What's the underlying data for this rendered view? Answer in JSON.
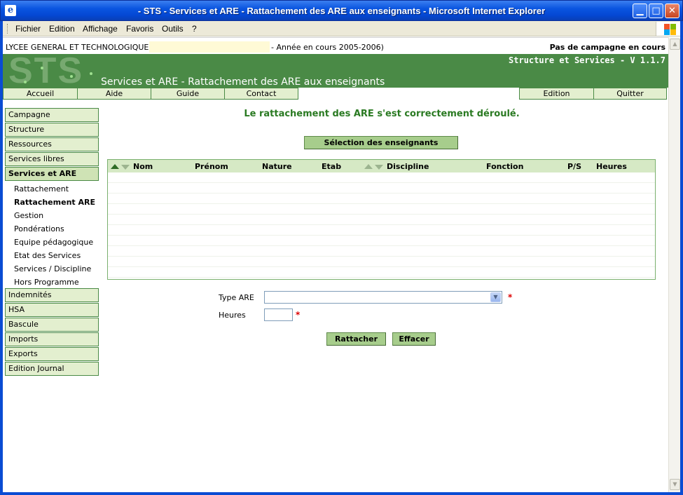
{
  "window": {
    "title": "- STS - Services et ARE - Rattachement des ARE aux enseignants - Microsoft Internet Explorer",
    "app_icon": "e",
    "min_glyph": "▁",
    "max_glyph": "□",
    "close_glyph": "✕"
  },
  "menubar": {
    "items": [
      "Fichier",
      "Edition",
      "Affichage",
      "Favoris",
      "Outils",
      "?"
    ]
  },
  "header": {
    "lycee": "LYCEE GENERAL ET TECHNOLOGIQUE",
    "annee": "- Année en cours 2005-2006)",
    "campagne": "Pas de campagne en cours"
  },
  "banner": {
    "logo": "STS",
    "version": "Structure et Services - V 1.1.7",
    "page_title": "Services et ARE - Rattachement des ARE aux enseignants",
    "color": "#4a8a46"
  },
  "tabs": {
    "left": [
      "Accueil",
      "Aide",
      "Guide",
      "Contact"
    ],
    "right": [
      "Edition",
      "Quitter"
    ]
  },
  "sidebar": {
    "items_top": [
      "Campagne",
      "Structure",
      "Ressources",
      "Services libres",
      "Services et ARE"
    ],
    "sub_items": [
      "Rattachement",
      "Rattachement ARE",
      "Gestion",
      "Pondérations",
      "Equipe pédagogique",
      "Etat des Services",
      "Services / Discipline",
      "Hors Programme"
    ],
    "items_bottom": [
      "Indemnités",
      "HSA",
      "Bascule",
      "Imports",
      "Exports",
      "Edition Journal"
    ]
  },
  "main": {
    "message": "Le rattachement des ARE s'est correctement déroulé.",
    "select_teachers_button": "Sélection des enseignants",
    "table_headers": [
      "Nom",
      "Prénom",
      "Nature",
      "Etab",
      "Discipline",
      "Fonction",
      "P/S",
      "Heures"
    ],
    "type_are_label": "Type ARE",
    "type_are_value": "",
    "heures_label": "Heures",
    "heures_value": "",
    "required_mark": "*",
    "attach_button": "Rattacher",
    "clear_button": "Effacer",
    "message_color": "#2a7a22"
  }
}
